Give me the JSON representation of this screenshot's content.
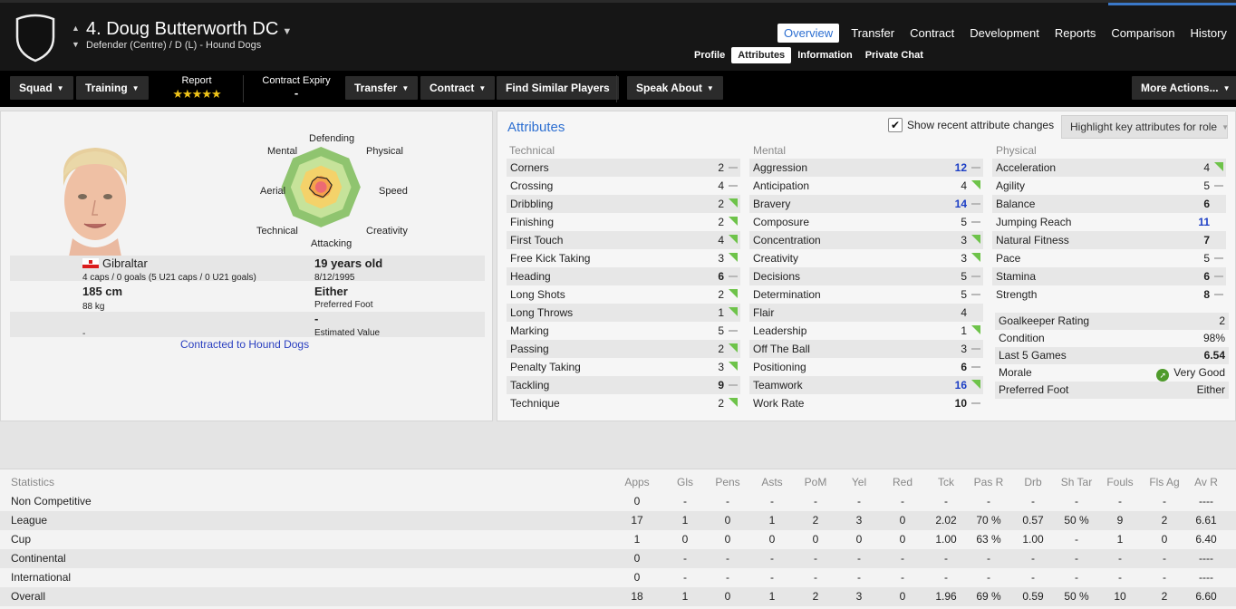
{
  "header": {
    "player_name": "4. Doug Butterworth DC",
    "subtitle": "Defender (Centre) / D (L) - Hound Dogs",
    "main_tabs": [
      {
        "label": "Overview",
        "selected": true
      },
      {
        "label": "Transfer"
      },
      {
        "label": "Contract"
      },
      {
        "label": "Development"
      },
      {
        "label": "Reports"
      },
      {
        "label": "Comparison"
      },
      {
        "label": "History"
      }
    ],
    "sub_tabs": [
      {
        "label": "Profile"
      },
      {
        "label": "Attributes",
        "selected": true
      },
      {
        "label": "Information"
      },
      {
        "label": "Private Chat"
      }
    ]
  },
  "toolbar": {
    "squad": "Squad",
    "training": "Training",
    "report_label": "Report",
    "report_stars": "★★★★★",
    "contract_expiry_label": "Contract Expiry",
    "contract_expiry_value": "-",
    "transfer": "Transfer",
    "contract": "Contract",
    "find_similar": "Find Similar Players",
    "speak_about": "Speak About",
    "more_actions": "More Actions..."
  },
  "profile": {
    "radar_labels": {
      "top": "Defending",
      "top_right": "Physical",
      "right": "Speed",
      "bottom_right": "Creativity",
      "bottom": "Attacking",
      "bottom_left": "Technical",
      "left": "Aerial",
      "top_left": "Mental"
    },
    "nationality": "Gibraltar",
    "caps": "4 caps / 0 goals (5 U21 caps / 0 U21 goals)",
    "age": "19 years old",
    "dob": "8/12/1995",
    "height": "185 cm",
    "weight": "88 kg",
    "preferred_foot_value": "Either",
    "preferred_foot_label": "Preferred Foot",
    "bottom_left_value": "-",
    "estimated_value": "-",
    "estimated_value_label": "Estimated Value",
    "contracted": "Contracted to Hound Dogs"
  },
  "attributes": {
    "title": "Attributes",
    "show_changes_label": "Show recent attribute changes",
    "show_changes_checked": true,
    "highlight_button": "Highlight key attributes for role",
    "technical_header": "Technical",
    "mental_header": "Mental",
    "physical_header": "Physical",
    "technical": [
      {
        "name": "Corners",
        "value": "2",
        "trend": "dash"
      },
      {
        "name": "Crossing",
        "value": "4",
        "trend": "dash"
      },
      {
        "name": "Dribbling",
        "value": "2",
        "trend": "up"
      },
      {
        "name": "Finishing",
        "value": "2",
        "trend": "up"
      },
      {
        "name": "First Touch",
        "value": "4",
        "trend": "up"
      },
      {
        "name": "Free Kick Taking",
        "value": "3",
        "trend": "up"
      },
      {
        "name": "Heading",
        "value": "6",
        "trend": "dash",
        "bold": true
      },
      {
        "name": "Long Shots",
        "value": "2",
        "trend": "up"
      },
      {
        "name": "Long Throws",
        "value": "1",
        "trend": "up"
      },
      {
        "name": "Marking",
        "value": "5",
        "trend": "dash"
      },
      {
        "name": "Passing",
        "value": "2",
        "trend": "up"
      },
      {
        "name": "Penalty Taking",
        "value": "3",
        "trend": "up"
      },
      {
        "name": "Tackling",
        "value": "9",
        "trend": "dash",
        "bold": true
      },
      {
        "name": "Technique",
        "value": "2",
        "trend": "up"
      }
    ],
    "mental": [
      {
        "name": "Aggression",
        "value": "12",
        "trend": "dash",
        "highlight": true
      },
      {
        "name": "Anticipation",
        "value": "4",
        "trend": "up"
      },
      {
        "name": "Bravery",
        "value": "14",
        "trend": "dash",
        "highlight": true
      },
      {
        "name": "Composure",
        "value": "5",
        "trend": "dash"
      },
      {
        "name": "Concentration",
        "value": "3",
        "trend": "up"
      },
      {
        "name": "Creativity",
        "value": "3",
        "trend": "up"
      },
      {
        "name": "Decisions",
        "value": "5",
        "trend": "dash"
      },
      {
        "name": "Determination",
        "value": "5",
        "trend": "dash"
      },
      {
        "name": "Flair",
        "value": "4",
        "trend": "down"
      },
      {
        "name": "Leadership",
        "value": "1",
        "trend": "up"
      },
      {
        "name": "Off The Ball",
        "value": "3",
        "trend": "dash"
      },
      {
        "name": "Positioning",
        "value": "6",
        "trend": "dash",
        "bold": true
      },
      {
        "name": "Teamwork",
        "value": "16",
        "trend": "up",
        "highlight": true
      },
      {
        "name": "Work Rate",
        "value": "10",
        "trend": "dash",
        "bold": true
      }
    ],
    "physical": [
      {
        "name": "Acceleration",
        "value": "4",
        "trend": "up"
      },
      {
        "name": "Agility",
        "value": "5",
        "trend": "dash"
      },
      {
        "name": "Balance",
        "value": "6",
        "trend": "down",
        "bold": true
      },
      {
        "name": "Jumping Reach",
        "value": "11",
        "trend": "down",
        "highlight": true
      },
      {
        "name": "Natural Fitness",
        "value": "7",
        "trend": "down",
        "bold": true
      },
      {
        "name": "Pace",
        "value": "5",
        "trend": "dash"
      },
      {
        "name": "Stamina",
        "value": "6",
        "trend": "dash",
        "bold": true
      },
      {
        "name": "Strength",
        "value": "8",
        "trend": "dash",
        "bold": true
      }
    ],
    "summary": [
      {
        "name": "Goalkeeper Rating",
        "value": "2"
      },
      {
        "name": "Condition",
        "value": "98%"
      },
      {
        "name": "Last 5 Games",
        "value": "6.54",
        "bold": true
      },
      {
        "name": "Morale",
        "value": "Very Good",
        "icon": true
      },
      {
        "name": "Preferred Foot",
        "value": "Either"
      }
    ]
  },
  "statistics": {
    "headers": [
      "Statistics",
      "Apps",
      "Gls",
      "Pens",
      "Asts",
      "PoM",
      "Yel",
      "Red",
      "Tck",
      "Pas R",
      "Drb",
      "Sh Tar",
      "Fouls",
      "Fls Ag",
      "Av R"
    ],
    "rows": [
      [
        "Non Competitive",
        "0",
        "-",
        "-",
        "-",
        "-",
        "-",
        "-",
        "-",
        "-",
        "-",
        "-",
        "-",
        "-",
        "----"
      ],
      [
        "League",
        "17",
        "1",
        "0",
        "1",
        "2",
        "3",
        "0",
        "2.02",
        "70 %",
        "0.57",
        "50 %",
        "9",
        "2",
        "6.61"
      ],
      [
        "Cup",
        "1",
        "0",
        "0",
        "0",
        "0",
        "0",
        "0",
        "1.00",
        "63 %",
        "1.00",
        "-",
        "1",
        "0",
        "6.40"
      ],
      [
        "Continental",
        "0",
        "-",
        "-",
        "-",
        "-",
        "-",
        "-",
        "-",
        "-",
        "-",
        "-",
        "-",
        "-",
        "----"
      ],
      [
        "International",
        "0",
        "-",
        "-",
        "-",
        "-",
        "-",
        "-",
        "-",
        "-",
        "-",
        "-",
        "-",
        "-",
        "----"
      ],
      [
        "Overall",
        "18",
        "1",
        "0",
        "1",
        "2",
        "3",
        "0",
        "1.96",
        "69 %",
        "0.59",
        "50 %",
        "10",
        "2",
        "6.60"
      ]
    ]
  }
}
